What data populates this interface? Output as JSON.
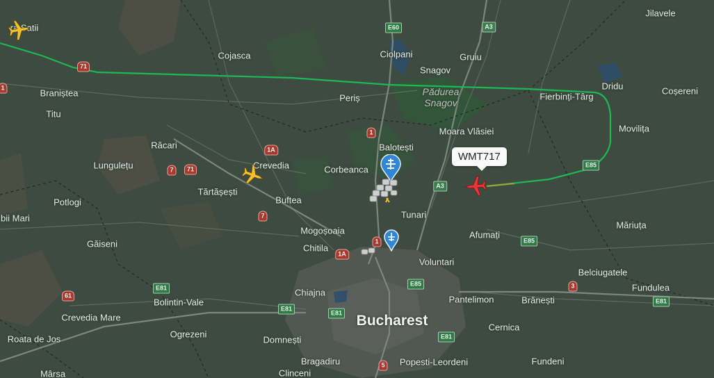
{
  "map": {
    "places": [
      {
        "id": "ra-satii",
        "label": "ra Satii"
      },
      {
        "id": "cojasca",
        "label": "Cojasca"
      },
      {
        "id": "ciolpani",
        "label": "Ciolpani"
      },
      {
        "id": "gruiu",
        "label": "Gruiu"
      },
      {
        "id": "jilavele",
        "label": "Jilavele"
      },
      {
        "id": "branistea",
        "label": "Braniștea"
      },
      {
        "id": "peris",
        "label": "Periș"
      },
      {
        "id": "snagov",
        "label": "Snagov"
      },
      {
        "id": "dridu",
        "label": "Dridu"
      },
      {
        "id": "cosereni",
        "label": "Coșereni"
      },
      {
        "id": "titu",
        "label": "Titu"
      },
      {
        "id": "fierbinti",
        "label": "Fierbinți-Târg"
      },
      {
        "id": "moara",
        "label": "Moara Vlăsiei"
      },
      {
        "id": "movilita",
        "label": "Movilița"
      },
      {
        "id": "racari",
        "label": "Răcari"
      },
      {
        "id": "balotesti",
        "label": "Balotești"
      },
      {
        "id": "lungulet",
        "label": "Lungulețu"
      },
      {
        "id": "crevedia",
        "label": "Crevedia"
      },
      {
        "id": "corbeanca",
        "label": "Corbeanca"
      },
      {
        "id": "tartasesti",
        "label": "Tărtășești"
      },
      {
        "id": "potlogi",
        "label": "Potlogi"
      },
      {
        "id": "buftea",
        "label": "Buftea"
      },
      {
        "id": "tunari",
        "label": "Tunari"
      },
      {
        "id": "bii-mari",
        "label": "bii Mari"
      },
      {
        "id": "mogosoaia",
        "label": "Mogoșoaia"
      },
      {
        "id": "mariuta",
        "label": "Măriuța"
      },
      {
        "id": "afumati",
        "label": "Afumați"
      },
      {
        "id": "gaiseni",
        "label": "Găiseni"
      },
      {
        "id": "chitila",
        "label": "Chitila"
      },
      {
        "id": "voluntari",
        "label": "Voluntari"
      },
      {
        "id": "belciugatele",
        "label": "Belciugatele"
      },
      {
        "id": "fundulea",
        "label": "Fundulea"
      },
      {
        "id": "chiajna",
        "label": "Chiajna"
      },
      {
        "id": "bolintin",
        "label": "Bolintin-Vale"
      },
      {
        "id": "pantelimon",
        "label": "Pantelimon"
      },
      {
        "id": "branesti",
        "label": "Brănești"
      },
      {
        "id": "crevedia-mare",
        "label": "Crevedia Mare"
      },
      {
        "id": "bucharest",
        "label": "Bucharest"
      },
      {
        "id": "cernica",
        "label": "Cernica"
      },
      {
        "id": "roata",
        "label": "Roata de Jos"
      },
      {
        "id": "ogrezeni",
        "label": "Ogrezeni"
      },
      {
        "id": "domnesti",
        "label": "Domnești"
      },
      {
        "id": "bragadiru",
        "label": "Bragadiru"
      },
      {
        "id": "popesti",
        "label": "Popesti-Leordeni"
      },
      {
        "id": "fundeni",
        "label": "Fundeni"
      },
      {
        "id": "marsa",
        "label": "Mârsa"
      },
      {
        "id": "clinceni",
        "label": "Clinceni"
      }
    ],
    "forest_label": "Pădurea\nSnagov",
    "road_shields": [
      {
        "label": "E60"
      },
      {
        "label": "A3"
      },
      {
        "label": "71"
      },
      {
        "label": "1"
      },
      {
        "label": "1A"
      },
      {
        "label": "7"
      },
      {
        "label": "71"
      },
      {
        "label": "A3"
      },
      {
        "label": "E85"
      },
      {
        "label": "7"
      },
      {
        "label": "1"
      },
      {
        "label": "1A"
      },
      {
        "label": "E85"
      },
      {
        "label": "E85"
      },
      {
        "label": "E81"
      },
      {
        "label": "61"
      },
      {
        "label": "E81"
      },
      {
        "label": "E81"
      },
      {
        "label": "3"
      },
      {
        "label": "E81"
      },
      {
        "label": "E81"
      },
      {
        "label": "5"
      },
      {
        "label": "1"
      }
    ],
    "flight": {
      "callsign": "WMT717",
      "route_color": "#1db954",
      "plane_color": "#e8373a"
    },
    "other_aircraft_color": "#f2c230"
  }
}
